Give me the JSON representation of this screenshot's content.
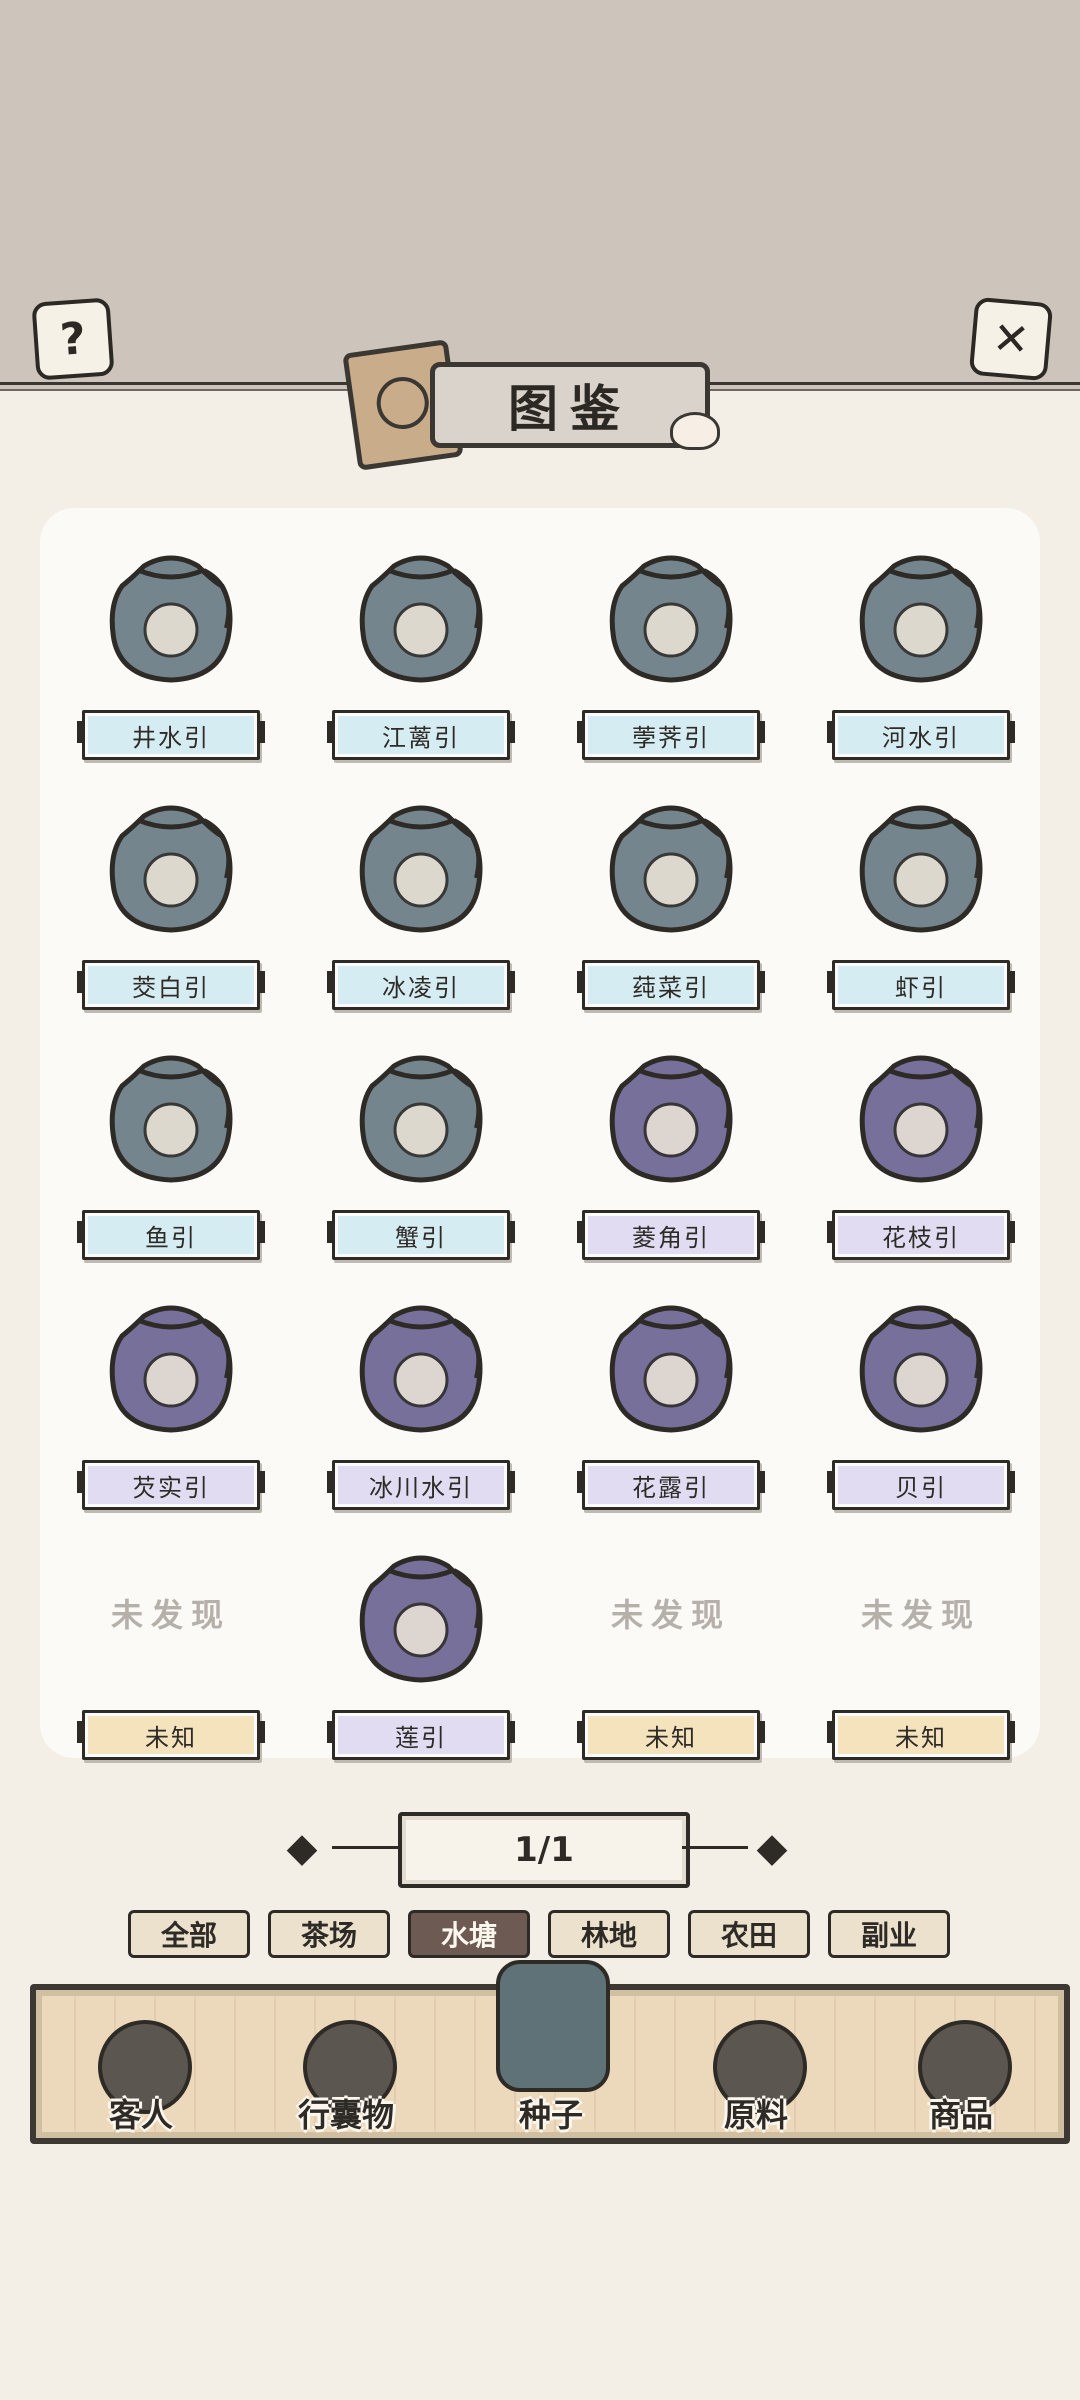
{
  "header": {
    "title": "图鉴",
    "help_icon": "question-mark-icon",
    "close_icon": "close-x-icon"
  },
  "items": [
    {
      "name": "井水引",
      "tier": "blue",
      "content": "wooden-bucket"
    },
    {
      "name": "江蓠引",
      "tier": "blue",
      "content": "seaweed"
    },
    {
      "name": "荸荠引",
      "tier": "blue",
      "content": "water-chestnut"
    },
    {
      "name": "河水引",
      "tier": "blue",
      "content": "ladle-water"
    },
    {
      "name": "茭白引",
      "tier": "blue",
      "content": "wild-rice-stem"
    },
    {
      "name": "冰凌引",
      "tier": "blue",
      "content": "icicle"
    },
    {
      "name": "莼菜引",
      "tier": "blue",
      "content": "water-shield-bowl"
    },
    {
      "name": "虾引",
      "tier": "blue",
      "content": "shrimp"
    },
    {
      "name": "鱼引",
      "tier": "blue",
      "content": "fish"
    },
    {
      "name": "蟹引",
      "tier": "blue",
      "content": "crab"
    },
    {
      "name": "菱角引",
      "tier": "purple",
      "content": "water-caltrop"
    },
    {
      "name": "花枝引",
      "tier": "purple",
      "content": "cuttlefish"
    },
    {
      "name": "芡实引",
      "tier": "purple",
      "content": "fox-nut-bowl"
    },
    {
      "name": "冰川水引",
      "tier": "purple",
      "content": "glacier-water-bowl"
    },
    {
      "name": "花露引",
      "tier": "purple",
      "content": "flower-dew"
    },
    {
      "name": "贝引",
      "tier": "purple",
      "content": "scallop"
    },
    {
      "name": "未知",
      "tier": "gold",
      "undiscovered": "未发现"
    },
    {
      "name": "莲引",
      "tier": "purple",
      "content": "lotus"
    },
    {
      "name": "未知",
      "tier": "gold",
      "undiscovered": "未发现"
    },
    {
      "name": "未知",
      "tier": "gold",
      "undiscovered": "未发现"
    }
  ],
  "pager": {
    "label": "1/1",
    "prev_icon": "arrow-left-icon",
    "next_icon": "arrow-right-icon"
  },
  "filters": [
    {
      "label": "全部",
      "active": false
    },
    {
      "label": "茶场",
      "active": false
    },
    {
      "label": "水塘",
      "active": true
    },
    {
      "label": "林地",
      "active": false
    },
    {
      "label": "农田",
      "active": false
    },
    {
      "label": "副业",
      "active": false
    }
  ],
  "nav": [
    {
      "label": "客人",
      "icon": "guest-icon",
      "active": false
    },
    {
      "label": "行囊物",
      "icon": "clothing-icon",
      "active": false
    },
    {
      "label": "种子",
      "icon": "seed-bag-icon",
      "active": true
    },
    {
      "label": "原料",
      "icon": "leaf-icon",
      "active": false
    },
    {
      "label": "商品",
      "icon": "goods-box-icon",
      "active": false
    }
  ],
  "colors": {
    "blue_bag": "#75858e",
    "purple_bag": "#76709a",
    "blue_plate": "#d6ecf3",
    "purple_plate": "#e2dcf2",
    "gold_plate": "#f4e3bd",
    "active_tab": "#6d5a53"
  }
}
